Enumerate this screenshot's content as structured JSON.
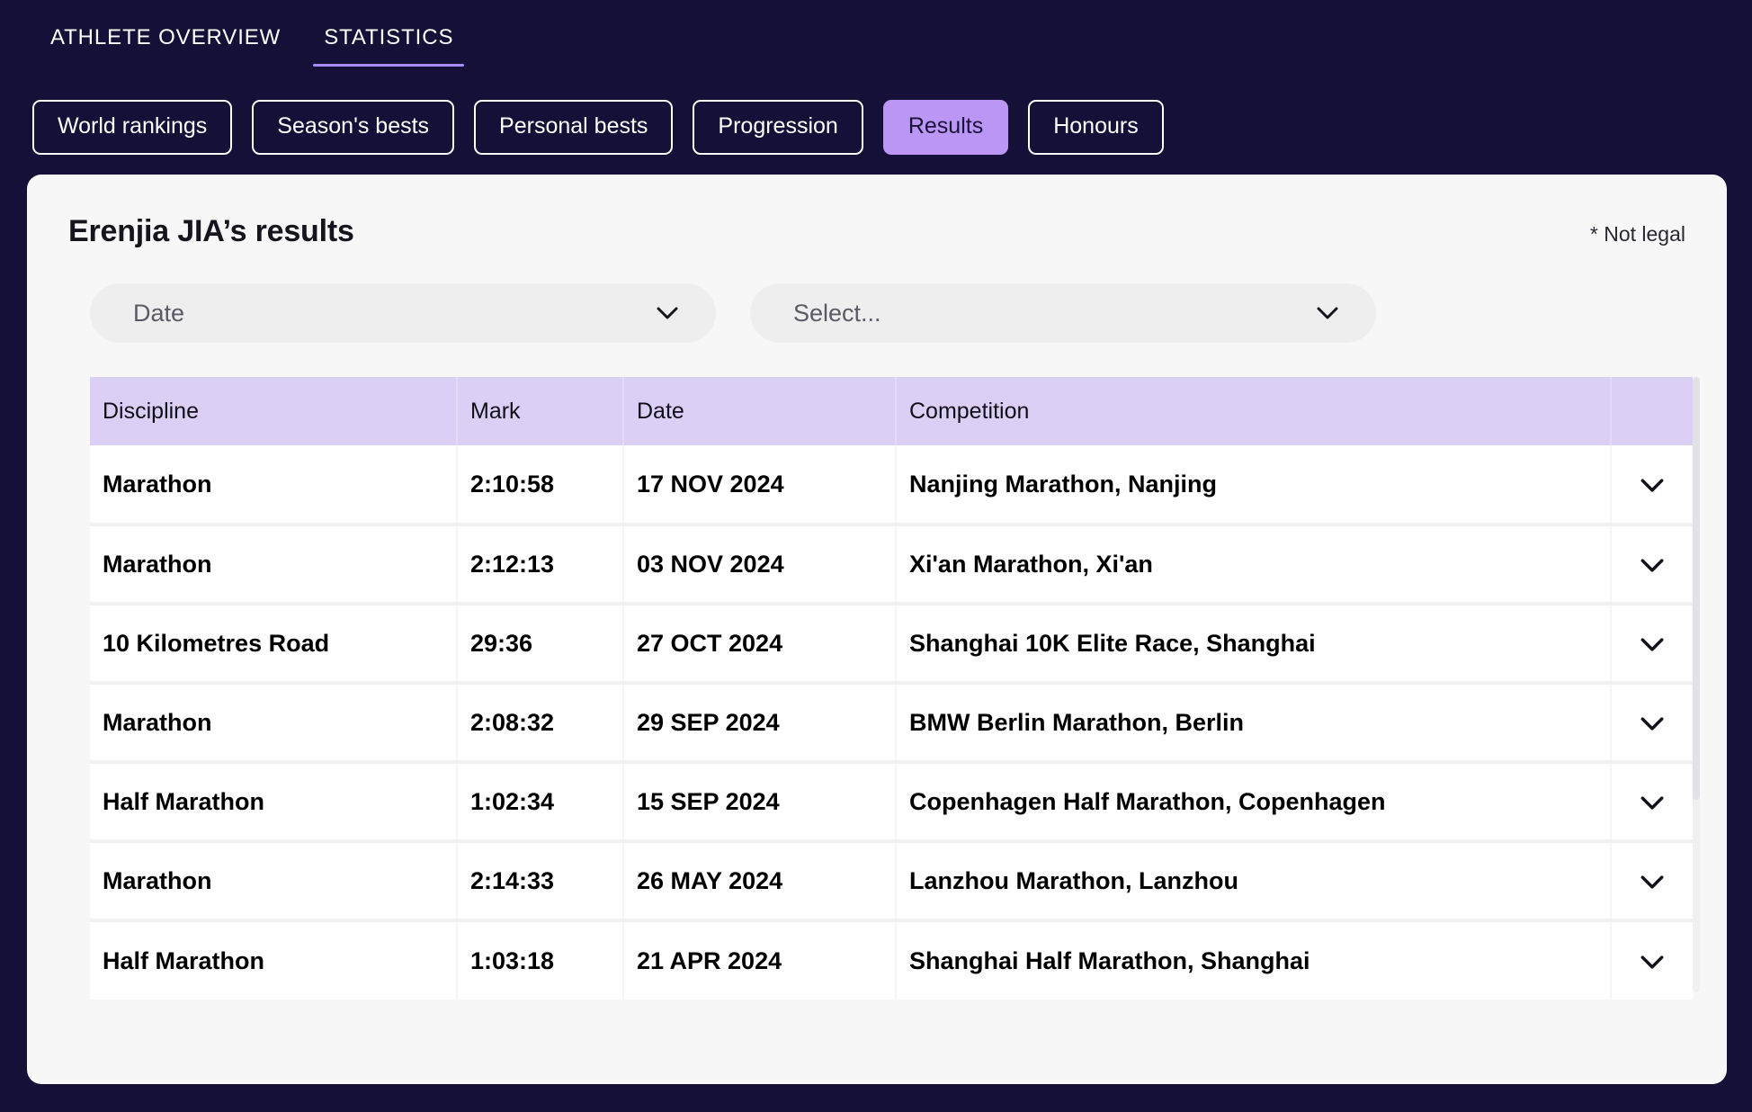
{
  "theme": {
    "page_bg": "#141037",
    "card_bg": "#f7f7f8",
    "accent": "#bb96f5",
    "tab_underline": "#a78bfa",
    "table_header_bg": "#dccff5"
  },
  "topnav": {
    "tabs": [
      {
        "label": "ATHLETE OVERVIEW",
        "active": false
      },
      {
        "label": "STATISTICS",
        "active": true
      }
    ]
  },
  "filter_pills": [
    {
      "label": "World rankings",
      "selected": false
    },
    {
      "label": "Season's bests",
      "selected": false
    },
    {
      "label": "Personal bests",
      "selected": false
    },
    {
      "label": "Progression",
      "selected": false
    },
    {
      "label": "Results",
      "selected": true
    },
    {
      "label": "Honours",
      "selected": false
    }
  ],
  "card": {
    "title": "Erenjia JIA’s results",
    "note": "* Not legal"
  },
  "selects": [
    {
      "name": "date",
      "value": "Date",
      "icon": "chevron-down-icon"
    },
    {
      "name": "discipline",
      "value": "Select...",
      "icon": "chevron-down-icon"
    }
  ],
  "results_table": {
    "columns": [
      "Discipline",
      "Mark",
      "Date",
      "Competition",
      ""
    ],
    "rows": [
      {
        "discipline": "Marathon",
        "mark": "2:10:58",
        "date": "17 NOV 2024",
        "competition": "Nanjing Marathon, Nanjing",
        "expand_icon": "chevron-down-icon"
      },
      {
        "discipline": "Marathon",
        "mark": "2:12:13",
        "date": "03 NOV 2024",
        "competition": "Xi'an Marathon, Xi'an",
        "expand_icon": "chevron-down-icon"
      },
      {
        "discipline": "10 Kilometres Road",
        "mark": "29:36",
        "date": "27 OCT 2024",
        "competition": "Shanghai 10K Elite Race, Shanghai",
        "expand_icon": "chevron-down-icon"
      },
      {
        "discipline": "Marathon",
        "mark": "2:08:32",
        "date": "29 SEP 2024",
        "competition": "BMW Berlin Marathon, Berlin",
        "expand_icon": "chevron-down-icon"
      },
      {
        "discipline": "Half Marathon",
        "mark": "1:02:34",
        "date": "15 SEP 2024",
        "competition": "Copenhagen Half Marathon, Copenhagen",
        "expand_icon": "chevron-down-icon"
      },
      {
        "discipline": "Marathon",
        "mark": "2:14:33",
        "date": "26 MAY 2024",
        "competition": "Lanzhou Marathon, Lanzhou",
        "expand_icon": "chevron-down-icon"
      },
      {
        "discipline": "Half Marathon",
        "mark": "1:03:18",
        "date": "21 APR 2024",
        "competition": "Shanghai Half Marathon, Shanghai",
        "expand_icon": "chevron-down-icon"
      }
    ]
  }
}
